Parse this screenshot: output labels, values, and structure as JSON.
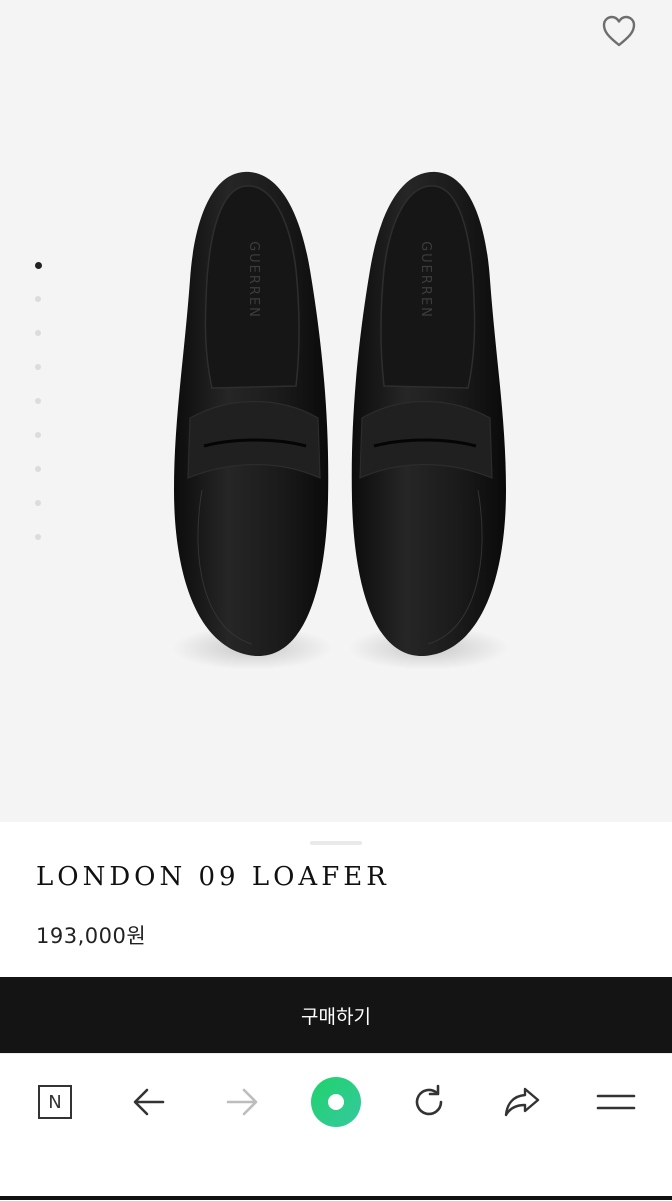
{
  "product": {
    "title": "LONDON 09 LOAFER",
    "price": "193,000원",
    "brand_embossed": "GUERREN",
    "favorite_icon": "heart-outline-icon",
    "gallery": {
      "image_count": 9,
      "current_index": 1
    }
  },
  "actions": {
    "buy_label": "구매하기"
  },
  "browser_nav": {
    "items": [
      {
        "name": "naver-home",
        "icon": "n-square-icon",
        "label": "N"
      },
      {
        "name": "back",
        "icon": "arrow-left-icon"
      },
      {
        "name": "forward",
        "icon": "arrow-right-icon",
        "disabled": true
      },
      {
        "name": "green-dot",
        "icon": "green-dot-icon"
      },
      {
        "name": "reload",
        "icon": "reload-icon"
      },
      {
        "name": "share",
        "icon": "share-icon"
      },
      {
        "name": "menu",
        "icon": "menu-icon"
      }
    ]
  },
  "colors": {
    "hero_bg": "#f4f4f4",
    "buy_bg": "#141414",
    "accent_green": "#2ad67a",
    "disabled_arrow": "#bdbdbd"
  }
}
